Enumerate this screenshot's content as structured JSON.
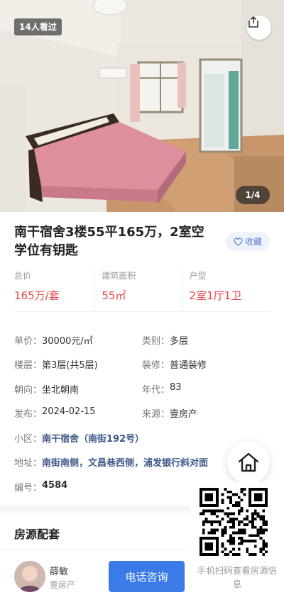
{
  "photo": {
    "views_badge": "14人看过",
    "page_indicator": "1/4",
    "share_icon": "share-icon"
  },
  "listing": {
    "title": "南干宿舍3楼55平165万，2室空学位有钥匙",
    "favorite_label": "收藏"
  },
  "stats": [
    {
      "label": "总价",
      "value": "165万/套"
    },
    {
      "label": "建筑面积",
      "value": "55㎡"
    },
    {
      "label": "户型",
      "value": "2室1厅1卫"
    }
  ],
  "details": {
    "unit_price": {
      "label": "单价：",
      "value": "30000元/㎡"
    },
    "category": {
      "label": "类别：",
      "value": "多层"
    },
    "floor": {
      "label": "楼层：",
      "value": "第3层(共5层)"
    },
    "decoration": {
      "label": "装修：",
      "value": "普通装修"
    },
    "orientation": {
      "label": "朝向：",
      "value": "坐北朝南"
    },
    "year": {
      "label": "年代：",
      "value": "83"
    },
    "published": {
      "label": "发布：",
      "value": "2024-02-15"
    },
    "source": {
      "label": "来源：",
      "value": "壹房产"
    },
    "community": {
      "label": "小区：",
      "value": "南干宿舍（南街192号）"
    },
    "address": {
      "label": "地址：",
      "value": "南街南侧，文昌巷西侧，浦发银行斜对面"
    },
    "code": {
      "label": "编号：",
      "value": "4584"
    }
  },
  "section": {
    "facilities_title": "房源配套"
  },
  "qr": {
    "caption": "手机扫码查看房源信息"
  },
  "agent": {
    "name": "薛敏",
    "company": "壹房产",
    "call_label": "电话咨询"
  },
  "colors": {
    "price_red": "#e8464a",
    "call_blue": "#3b7be8",
    "link_navy": "#3d5a8a"
  }
}
